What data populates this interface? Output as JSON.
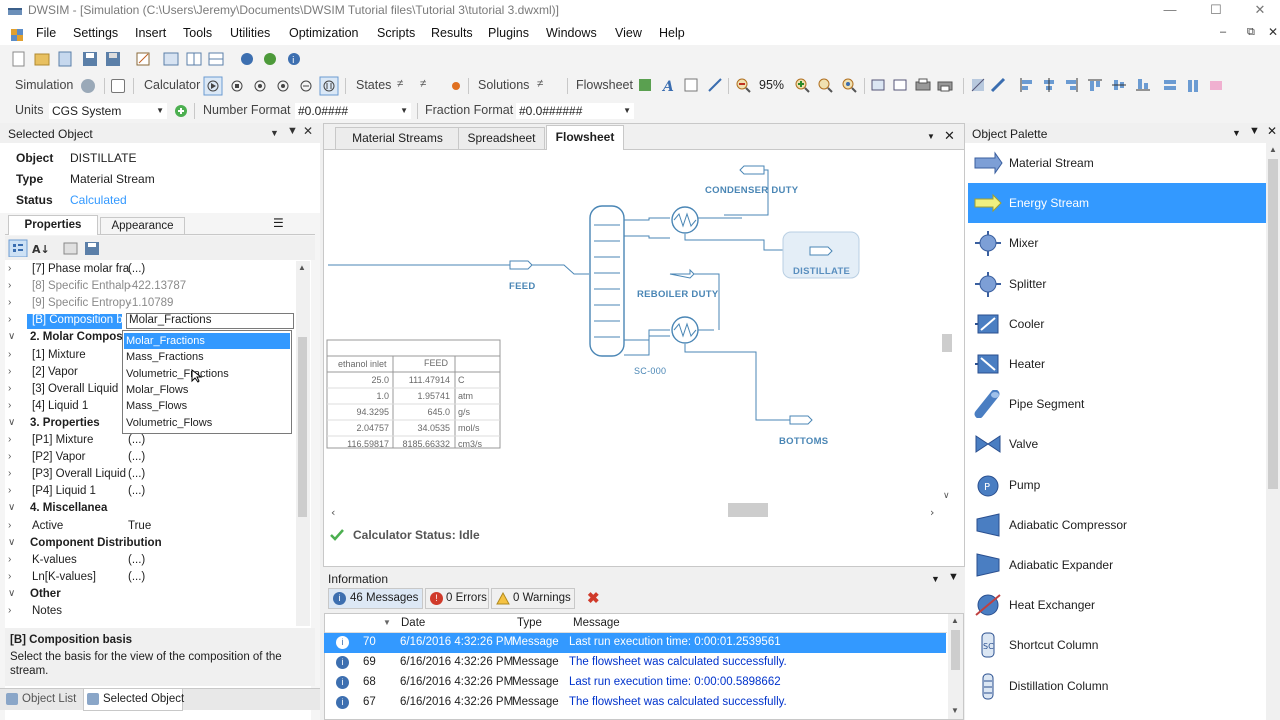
{
  "window": {
    "title": "DWSIM - [Simulation (C:\\Users\\Jeremy\\Documents\\DWSIM Tutorial files\\Tutorial 3\\tutorial 3.dwxml)]"
  },
  "menu": [
    "File",
    "Settings",
    "Insert",
    "Tools",
    "Utilities",
    "Optimization",
    "Scripts",
    "Results",
    "Plugins",
    "Windows",
    "View",
    "Help"
  ],
  "toolbar": {
    "simulation_label": "Simulation",
    "calculator_label": "Calculator",
    "states_label": "States",
    "solutions_label": "Solutions",
    "flowsheet_label": "Flowsheet",
    "zoom": "95%",
    "units_label": "Units",
    "units_value": "CGS System",
    "number_format_label": "Number Format",
    "number_format_value": "#0.0####",
    "fraction_format_label": "Fraction Format",
    "fraction_format_value": "#0.0######"
  },
  "selected_object": {
    "panel_title": "Selected Object",
    "object_label": "Object",
    "object_value": "DISTILLATE",
    "type_label": "Type",
    "type_value": "Material Stream",
    "status_label": "Status",
    "status_value": "Calculated",
    "tabs": [
      "Properties",
      "Appearance"
    ],
    "rows": [
      {
        "name": "[7] Phase molar fra",
        "value": "(...)",
        "style": "normal"
      },
      {
        "name": "[8] Specific Enthalp",
        "value": "-422.13787",
        "style": "gray"
      },
      {
        "name": "[9] Specific Entropy",
        "value": "-1.10789",
        "style": "gray"
      },
      {
        "name": "[B] Composition bas",
        "value": "Molar_Fractions",
        "style": "selected"
      },
      {
        "name": "2. Molar Compos",
        "value": "",
        "style": "category"
      },
      {
        "name": "[1] Mixture",
        "value": "",
        "style": "normal"
      },
      {
        "name": "[2] Vapor",
        "value": "",
        "style": "normal"
      },
      {
        "name": "[3] Overall Liquid",
        "value": "",
        "style": "normal"
      },
      {
        "name": "[4] Liquid 1",
        "value": "",
        "style": "normal"
      },
      {
        "name": "3. Properties",
        "value": "",
        "style": "category"
      },
      {
        "name": "[P1] Mixture",
        "value": "(...)",
        "style": "normal"
      },
      {
        "name": "[P2] Vapor",
        "value": "(...)",
        "style": "normal"
      },
      {
        "name": "[P3] Overall Liquid",
        "value": "(...)",
        "style": "normal"
      },
      {
        "name": "[P4] Liquid 1",
        "value": "(...)",
        "style": "normal"
      },
      {
        "name": "4. Miscellanea",
        "value": "",
        "style": "category"
      },
      {
        "name": "Active",
        "value": "True",
        "style": "normal"
      },
      {
        "name": "Component Distribution",
        "value": "",
        "style": "category"
      },
      {
        "name": "K-values",
        "value": "(...)",
        "style": "normal"
      },
      {
        "name": "Ln[K-values]",
        "value": "(...)",
        "style": "normal"
      },
      {
        "name": "Other",
        "value": "",
        "style": "category"
      },
      {
        "name": "Notes",
        "value": "",
        "style": "normal"
      }
    ],
    "dropdown_options": [
      "Molar_Fractions",
      "Mass_Fractions",
      "Volumetric_Fractions",
      "Molar_Flows",
      "Mass_Flows",
      "Volumetric_Flows"
    ],
    "help_title": "[B] Composition basis",
    "help_text": "Select the basis for the view of the composition of the stream.",
    "bottom_tabs": [
      "Object List",
      "Selected Object"
    ]
  },
  "document_tabs": [
    "Material Streams",
    "Spreadsheet",
    "Flowsheet"
  ],
  "flowsheet": {
    "labels": {
      "condenser": "CONDENSER DUTY",
      "distillate": "DISTILLATE",
      "feed": "FEED",
      "reboiler": "REBOILER DUTY",
      "column": "SC-000",
      "bottoms": "BOTTOMS"
    },
    "table": {
      "headers": [
        "ethanol inlet",
        "FEED",
        ""
      ],
      "rows": [
        [
          "25.0",
          "111.47914",
          "C"
        ],
        [
          "1.0",
          "1.95741",
          "atm"
        ],
        [
          "94.3295",
          "645.0",
          "g/s"
        ],
        [
          "2.04757",
          "34.0535",
          "mol/s"
        ],
        [
          "116.59817",
          "8185.66332",
          "cm3/s"
        ]
      ]
    },
    "calculator_status": "Calculator Status: Idle"
  },
  "information": {
    "title": "Information",
    "messages_count": "46 Messages",
    "errors_count": "0 Errors",
    "warnings_count": "0 Warnings",
    "columns": [
      "",
      "Date",
      "Type",
      "Message"
    ],
    "rows": [
      {
        "id": "70",
        "date": "6/16/2016 4:32:26 PM",
        "type": "Message",
        "message": "Last run execution time: 0:00:01.2539561"
      },
      {
        "id": "69",
        "date": "6/16/2016 4:32:26 PM",
        "type": "Message",
        "message": "The flowsheet was calculated successfully."
      },
      {
        "id": "68",
        "date": "6/16/2016 4:32:26 PM",
        "type": "Message",
        "message": "Last run execution time: 0:00:00.5898662"
      },
      {
        "id": "67",
        "date": "6/16/2016 4:32:26 PM",
        "type": "Message",
        "message": "The flowsheet was calculated successfully."
      }
    ]
  },
  "palette": {
    "title": "Object Palette",
    "items": [
      {
        "label": "Material Stream",
        "icon": "material-stream-icon"
      },
      {
        "label": "Energy Stream",
        "icon": "energy-stream-icon"
      },
      {
        "label": "Mixer",
        "icon": "mixer-icon"
      },
      {
        "label": "Splitter",
        "icon": "splitter-icon"
      },
      {
        "label": "Cooler",
        "icon": "cooler-icon"
      },
      {
        "label": "Heater",
        "icon": "heater-icon"
      },
      {
        "label": "Pipe Segment",
        "icon": "pipe-segment-icon"
      },
      {
        "label": "Valve",
        "icon": "valve-icon"
      },
      {
        "label": "Pump",
        "icon": "pump-icon"
      },
      {
        "label": "Adiabatic Compressor",
        "icon": "compressor-icon"
      },
      {
        "label": "Adiabatic Expander",
        "icon": "expander-icon"
      },
      {
        "label": "Heat Exchanger",
        "icon": "heat-exchanger-icon"
      },
      {
        "label": "Shortcut Column",
        "icon": "shortcut-column-icon"
      },
      {
        "label": "Distillation Column",
        "icon": "distillation-column-icon"
      }
    ]
  },
  "colors": {
    "accent": "#3399ff",
    "selection": "#3399ff",
    "flowsheet_line": "#4a86b5",
    "log_message": "#0033cc"
  }
}
